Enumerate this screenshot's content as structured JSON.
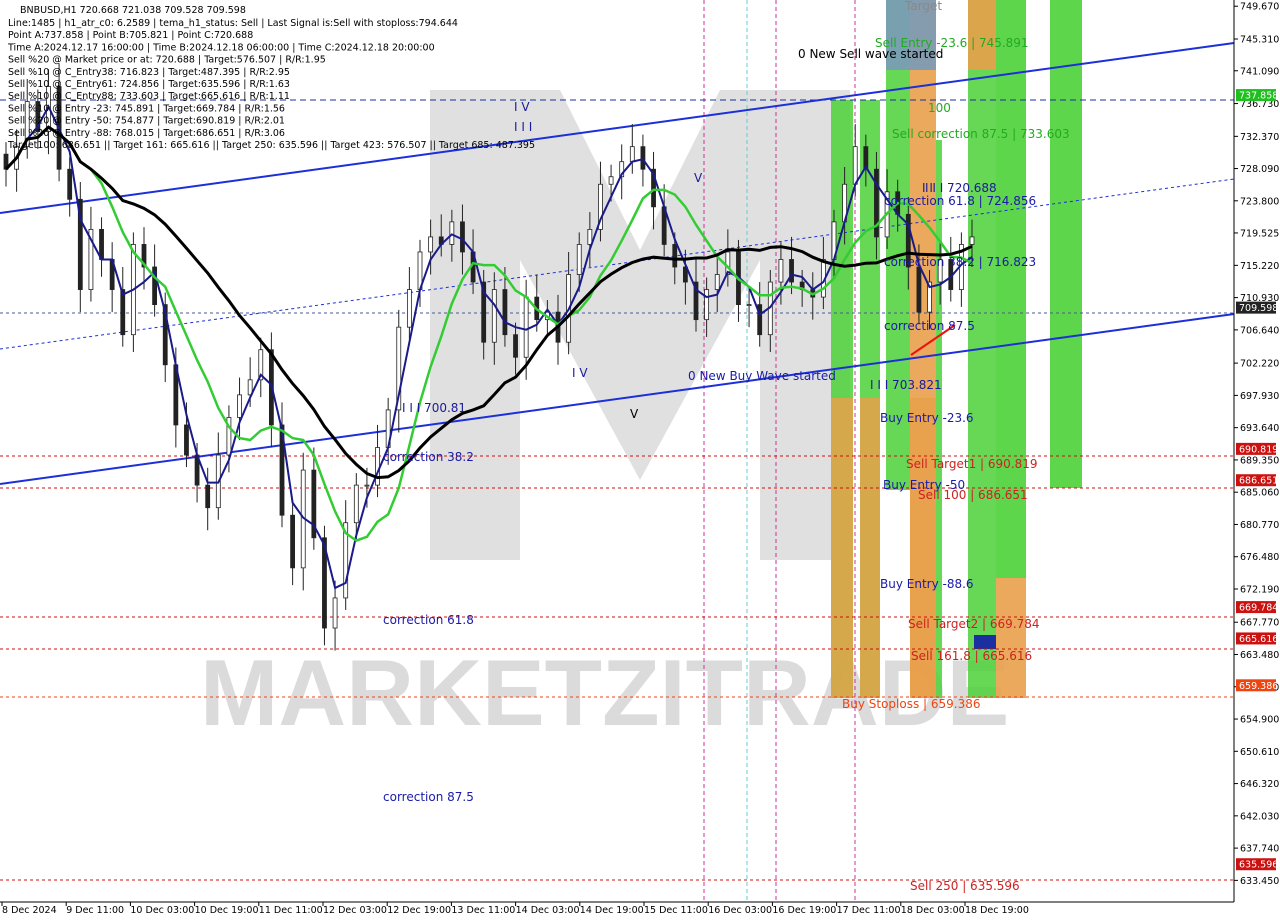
{
  "header": {
    "symbol_line": "BNBUSD,H1  720.668 721.038 709.528 709.598",
    "info_lines": [
      "Line:1485 | h1_atr_c0: 6.2589 | tema_h1_status: Sell | Last Signal is:Sell with stoploss:794.644",
      "Point A:737.858 | Point B:705.821 | Point C:720.688",
      "Time A:2024.12.17 16:00:00 | Time B:2024.12.18 06:00:00 | Time C:2024.12.18 20:00:00",
      "Sell %20 @ Market price or at: 720.688 | Target:576.507 | R/R:1.95",
      "Sell %10 @ C_Entry38: 716.823 | Target:487.395 | R/R:2.95",
      "Sell %10 @ C_Entry61: 724.856 | Target:635.596 | R/R:1.63",
      "Sell %10 @ C_Entry88: 733.603 | Target:665.616 | R/R:1.11",
      "Sell %10 @ Entry -23: 745.891 | Target:669.784 | R/R:1.56",
      "Sell %20 @ Entry -50: 754.877 | Target:690.819 | R/R:2.01",
      "Sell %20 @ Entry -88: 768.015 | Target:686.651 | R/R:3.06",
      "Target100: 686.651 || Target 161: 665.616 || Target 250: 635.596 || Target 423: 576.507 || Target 685: 487.395"
    ]
  },
  "watermark": "MARKETZITRADE",
  "chart_data": {
    "type": "candlestick",
    "symbol": "BNBUSD",
    "timeframe": "H1",
    "ohlc": {
      "open": 720.668,
      "high": 721.038,
      "low": 709.528,
      "close": 709.598
    },
    "ylim": [
      633.5,
      749.7
    ],
    "y_ticks": [
      "749.670",
      "745.310",
      "741.090",
      "736.730",
      "732.370",
      "728.090",
      "723.800",
      "719.525",
      "715.220",
      "710.930",
      "706.640",
      "702.220",
      "697.930",
      "693.640",
      "689.350",
      "685.060",
      "680.770",
      "676.480",
      "672.190",
      "667.770",
      "663.480",
      "659.190",
      "654.900",
      "650.610",
      "646.320",
      "642.030",
      "637.740",
      "633.450"
    ],
    "x_ticks": [
      "8 Dec 2024",
      "9 Dec 11:00",
      "10 Dec 03:00",
      "10 Dec 19:00",
      "11 Dec 11:00",
      "12 Dec 03:00",
      "12 Dec 19:00",
      "13 Dec 11:00",
      "14 Dec 03:00",
      "14 Dec 19:00",
      "15 Dec 11:00",
      "16 Dec 03:00",
      "16 Dec 19:00",
      "17 Dec 11:00",
      "18 Dec 03:00",
      "18 Dec 19:00"
    ],
    "price_tags": [
      {
        "value": 737.858,
        "label": "737.858",
        "color": "#1fbf1f"
      },
      {
        "value": 709.598,
        "label": "709.598",
        "color": "#222222"
      },
      {
        "value": 690.819,
        "label": "690.819",
        "color": "#cc1111"
      },
      {
        "value": 686.651,
        "label": "686.651",
        "color": "#cc1111"
      },
      {
        "value": 669.784,
        "label": "669.784",
        "color": "#cc1111"
      },
      {
        "value": 665.616,
        "label": "665.616",
        "color": "#cc1111"
      },
      {
        "value": 659.386,
        "label": "659.386",
        "color": "#ee4411"
      },
      {
        "value": 635.596,
        "label": "635.596",
        "color": "#cc1111"
      }
    ],
    "annotations": [
      {
        "text": "Sell Entry -23.6 | 745.891",
        "color": "#22aa22"
      },
      {
        "text": "0 New Sell wave started",
        "color": "#000000"
      },
      {
        "text": "Sell correction 87.5 | 733.603",
        "color": "#22aa22"
      },
      {
        "text": "I I I 720.688",
        "color": "#1a1a9a"
      },
      {
        "text": "correction 61.8 | 724.856",
        "color": "#1a1aaa"
      },
      {
        "text": "correction 38.2 | 716.823",
        "color": "#1a1aaa"
      },
      {
        "text": "correction 87.5",
        "color": "#1a1aaa"
      },
      {
        "text": "0 New Buy Wave started",
        "color": "#1a1aaa"
      },
      {
        "text": "I I I 703.821",
        "color": "#1a1a9a"
      },
      {
        "text": "Buy Entry -23.6",
        "color": "#1a1aaa"
      },
      {
        "text": "Sell Target1 | 690.819",
        "color": "#cc2222"
      },
      {
        "text": "Buy Entry -50",
        "color": "#1a1aaa"
      },
      {
        "text": "Sell 100 | 686.651",
        "color": "#cc2222"
      },
      {
        "text": "Buy Entry -88.6",
        "color": "#1a1aaa"
      },
      {
        "text": "Sell Target2 | 669.784",
        "color": "#cc2222"
      },
      {
        "text": "Sell 161.8 | 665.616",
        "color": "#cc2222"
      },
      {
        "text": "Buy Stoploss | 659.386",
        "color": "#ee4411"
      },
      {
        "text": "Sell 250 | 635.596",
        "color": "#cc2222"
      },
      {
        "text": "I I I 700.81",
        "color": "#1a1a9a"
      },
      {
        "text": "correction 38.2",
        "color": "#1a1aaa"
      },
      {
        "text": "correction 61.8",
        "color": "#1a1aaa"
      },
      {
        "text": "correction 87.5",
        "color": "#1a1aaa"
      },
      {
        "text": "I V",
        "color": "#1a1a9a"
      },
      {
        "text": "I I I",
        "color": "#1a1a9a"
      },
      {
        "text": "I V",
        "color": "#1a1a9a"
      },
      {
        "text": "V",
        "color": "#1a1a9a"
      },
      {
        "text": "V",
        "color": "#000000"
      },
      {
        "text": "100",
        "color": "#22aa22"
      },
      {
        "text": "Target",
        "color": "#888888"
      },
      {
        "text": "I I",
        "color": "#1a1a9a"
      }
    ],
    "close_series": [
      728,
      731,
      737,
      733,
      739,
      728,
      724,
      712,
      720,
      716,
      712,
      706,
      718,
      715,
      710,
      702,
      694,
      690,
      686,
      683,
      690,
      695,
      698,
      700,
      704,
      694,
      682,
      675,
      688,
      679,
      667,
      671,
      681,
      686,
      686,
      691,
      696,
      707,
      712,
      717,
      719,
      718,
      721,
      717,
      713,
      705,
      712,
      706,
      703,
      711,
      708,
      709,
      705,
      714,
      718,
      720,
      726,
      727,
      729,
      731,
      728,
      723,
      718,
      715,
      713,
      708,
      712,
      714,
      717,
      710,
      710,
      706,
      713,
      716,
      713,
      712,
      711,
      716,
      721,
      726,
      731,
      728,
      719,
      725,
      722,
      715,
      709,
      713,
      716,
      712,
      718,
      719
    ]
  }
}
